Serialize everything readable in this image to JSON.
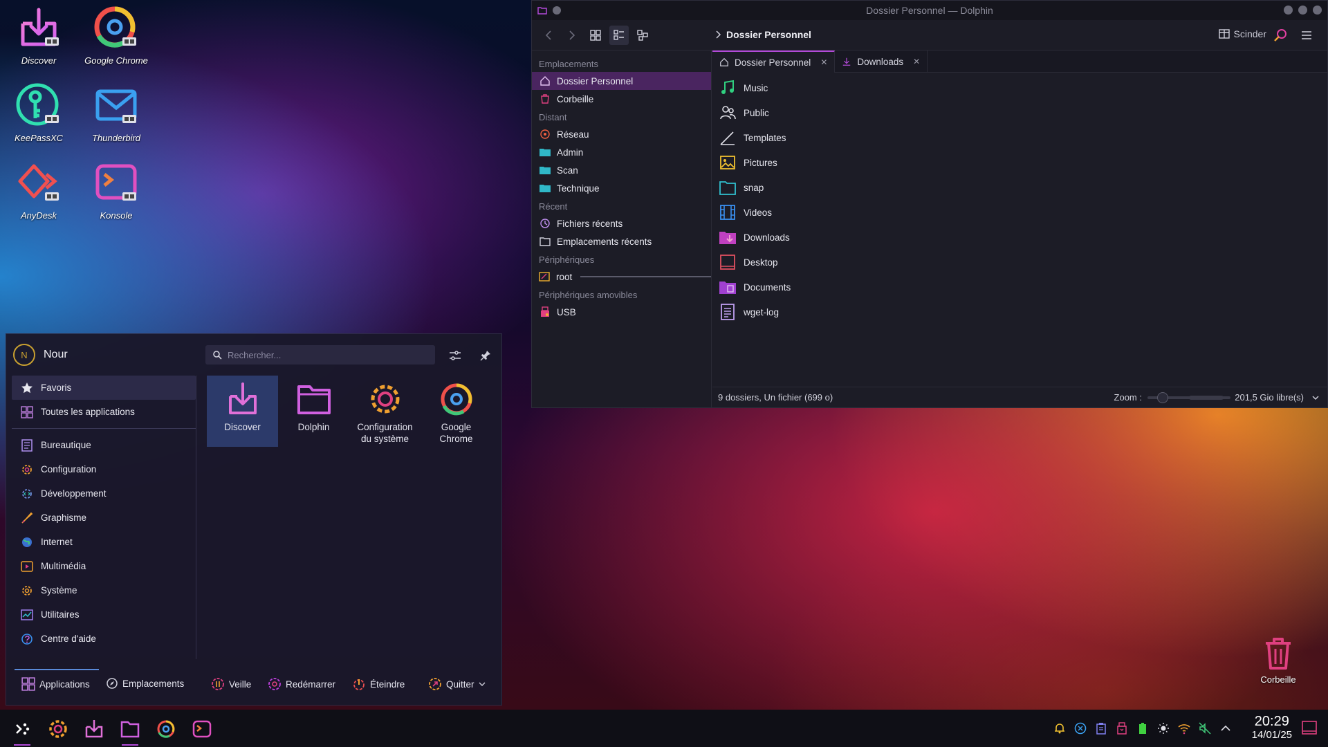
{
  "desktop": {
    "icons": [
      {
        "label": "Discover"
      },
      {
        "label": "Google Chrome"
      },
      {
        "label": "KeePassXC"
      },
      {
        "label": "Thunderbird"
      },
      {
        "label": "AnyDesk"
      },
      {
        "label": "Konsole"
      }
    ],
    "trash_label": "Corbeille"
  },
  "dolphin": {
    "title": "Dossier Personnel — Dolphin",
    "breadcrumb": "Dossier Personnel",
    "split_label": "Scinder",
    "sections": {
      "places": "Emplacements",
      "remote": "Distant",
      "recent": "Récent",
      "devices": "Périphériques",
      "removable": "Périphériques amovibles"
    },
    "places": [
      {
        "label": "Dossier Personnel"
      },
      {
        "label": "Corbeille"
      }
    ],
    "remote": [
      {
        "label": "Réseau"
      },
      {
        "label": "Admin"
      },
      {
        "label": "Scan"
      },
      {
        "label": "Technique"
      }
    ],
    "recent": [
      {
        "label": "Fichiers récents"
      },
      {
        "label": "Emplacements récents"
      }
    ],
    "devices": [
      {
        "label": "root"
      }
    ],
    "removable": [
      {
        "label": "USB"
      }
    ],
    "tabs": [
      {
        "label": "Dossier Personnel"
      },
      {
        "label": "Downloads"
      }
    ],
    "files": [
      {
        "name": "Music"
      },
      {
        "name": "Public"
      },
      {
        "name": "Templates"
      },
      {
        "name": "Pictures"
      },
      {
        "name": "snap"
      },
      {
        "name": "Videos"
      },
      {
        "name": "Downloads"
      },
      {
        "name": "Desktop"
      },
      {
        "name": "Documents"
      },
      {
        "name": "wget-log"
      }
    ],
    "status": "9 dossiers, Un fichier (699 o)",
    "zoom_label": "Zoom :",
    "free_space": "201,5 Gio libre(s)"
  },
  "launcher": {
    "user_initial": "N",
    "user_name": "Nour",
    "search_placeholder": "Rechercher...",
    "categories_top": [
      {
        "label": "Favoris"
      },
      {
        "label": "Toutes les applications"
      }
    ],
    "categories": [
      {
        "label": "Bureautique"
      },
      {
        "label": "Configuration"
      },
      {
        "label": "Développement"
      },
      {
        "label": "Graphisme"
      },
      {
        "label": "Internet"
      },
      {
        "label": "Multimédia"
      },
      {
        "label": "Système"
      },
      {
        "label": "Utilitaires"
      },
      {
        "label": "Centre d'aide"
      }
    ],
    "favorites": [
      {
        "line1": "Discover",
        "line2": ""
      },
      {
        "line1": "Dolphin",
        "line2": ""
      },
      {
        "line1": "Configuration",
        "line2": "du système"
      },
      {
        "line1": "Google",
        "line2": "Chrome"
      }
    ],
    "footer": {
      "applications": "Applications",
      "places": "Emplacements",
      "sleep": "Veille",
      "restart": "Redémarrer",
      "shutdown": "Éteindre",
      "quit": "Quitter"
    }
  },
  "taskbar": {
    "time": "20:29",
    "date": "14/01/25"
  },
  "colors": {
    "accent": "#b24ad8",
    "selection": "#4a2560",
    "panel_bg": "#1c1c26"
  }
}
